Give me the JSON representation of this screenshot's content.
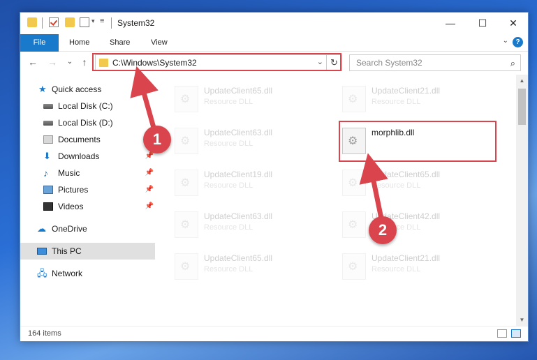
{
  "window": {
    "title": "System32",
    "minimize_glyph": "—",
    "maximize_glyph": "☐",
    "close_glyph": "✕"
  },
  "ribbon": {
    "file_tab": "File",
    "tabs": [
      "Home",
      "Share",
      "View"
    ],
    "help_glyph": "?",
    "expand_glyph": "⌄"
  },
  "nav": {
    "back_glyph": "←",
    "forward_glyph": "→",
    "recent_glyph": "⌄",
    "up_glyph": "↑",
    "address": "C:\\Windows\\System32",
    "address_dropdown_glyph": "⌄",
    "refresh_glyph": "↻",
    "search_placeholder": "Search System32",
    "search_glyph": "⌕"
  },
  "sidebar": {
    "items": [
      {
        "label": "Quick access",
        "icon": "star-icon"
      },
      {
        "label": "Local Disk (C:)",
        "icon": "drive-icon"
      },
      {
        "label": "Local Disk (D:)",
        "icon": "drive-icon"
      },
      {
        "label": "Documents",
        "icon": "documents-icon"
      },
      {
        "label": "Downloads",
        "icon": "download-icon"
      },
      {
        "label": "Music",
        "icon": "music-icon"
      },
      {
        "label": "Pictures",
        "icon": "pictures-icon"
      },
      {
        "label": "Videos",
        "icon": "videos-icon"
      },
      {
        "label": "OneDrive",
        "icon": "cloud-icon"
      },
      {
        "label": "This PC",
        "icon": "computer-icon"
      },
      {
        "label": "Network",
        "icon": "network-icon"
      }
    ],
    "pin_glyph": "📌",
    "star_glyph": "★",
    "download_glyph": "⬇",
    "music_glyph": "♪",
    "cloud_glyph": "☁",
    "network_glyph": "🖧"
  },
  "files": [
    {
      "name": "UpdateClient65.dll",
      "desc": "Resource DLL"
    },
    {
      "name": "UpdateClient21.dll",
      "desc": "Resource DLL"
    },
    {
      "name": "UpdateClient63.dll",
      "desc": "Resource DLL"
    },
    {
      "name": "morphlib.dll",
      "desc": ""
    },
    {
      "name": "UpdateClient19.dll",
      "desc": "Resource DLL"
    },
    {
      "name": "UpdateClient65.dll",
      "desc": "Resource DLL"
    },
    {
      "name": "UpdateClient63.dll",
      "desc": "Resource DLL"
    },
    {
      "name": "UpdateClient42.dll",
      "desc": "Resource DLL"
    },
    {
      "name": "UpdateClient65.dll",
      "desc": "Resource DLL"
    },
    {
      "name": "UpdateClient21.dll",
      "desc": "Resource DLL"
    }
  ],
  "status": {
    "item_count": "164 items"
  },
  "annotations": {
    "step1": "1",
    "step2": "2",
    "color": "#d9444d"
  },
  "colors": {
    "accent": "#1979ca",
    "highlight": "#d9444d"
  }
}
